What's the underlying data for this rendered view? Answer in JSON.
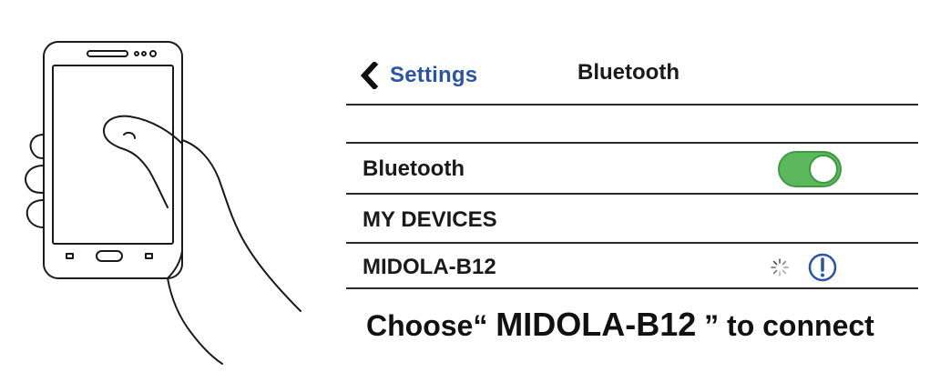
{
  "nav": {
    "back_label": "Settings",
    "title": "Bluetooth"
  },
  "rows": {
    "bluetooth_label": "Bluetooth",
    "bluetooth_enabled": true,
    "section_header": "MY DEVICES",
    "device_name": "MIDOLA-B12",
    "device_status": "connecting"
  },
  "instruction": {
    "prefix": "Choose“ ",
    "device": "MIDOLA-B12",
    "suffix": " ” to connect"
  },
  "icons": {
    "back": "chevron-left-icon",
    "spinner": "spinner-icon",
    "info": "info-icon",
    "phone": "phone-in-hand-illustration"
  },
  "colors": {
    "link": "#2b54a5",
    "toggle_on": "#5cb85c",
    "info": "#2b54a5",
    "text": "#1a1a1a"
  }
}
